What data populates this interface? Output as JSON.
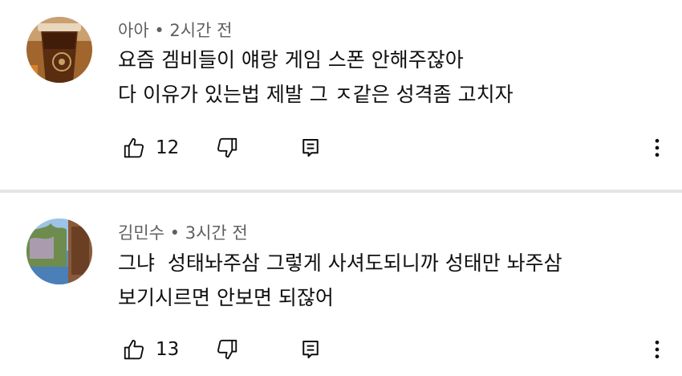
{
  "comments": [
    {
      "author": "아아",
      "separator": "•",
      "time": "2시간 전",
      "lines": [
        "요즘 겜비들이 얘랑 게임 스폰 안해주잖아",
        "다 이유가 있는법 제발 그 ㅈ같은 성격좀 고치자"
      ],
      "like_count": "12",
      "icons": {
        "like": "thumbs-up-icon",
        "dislike": "thumbs-down-icon",
        "reply": "reply-icon",
        "more": "more-vertical-icon"
      }
    },
    {
      "author": "김민수",
      "separator": "•",
      "time": "3시간 전",
      "lines": [
        "그냐  성태놔주삼 그렇게 사셔도되니까 성태만 놔주삼",
        "보기시르면 안보면 되잖어"
      ],
      "like_count": "13",
      "icons": {
        "like": "thumbs-up-icon",
        "dislike": "thumbs-down-icon",
        "reply": "reply-icon",
        "more": "more-vertical-icon"
      }
    }
  ],
  "colors": {
    "text": "#0f0f0f",
    "meta": "#606060",
    "divider": "#e5e5e5",
    "background": "#ffffff"
  }
}
